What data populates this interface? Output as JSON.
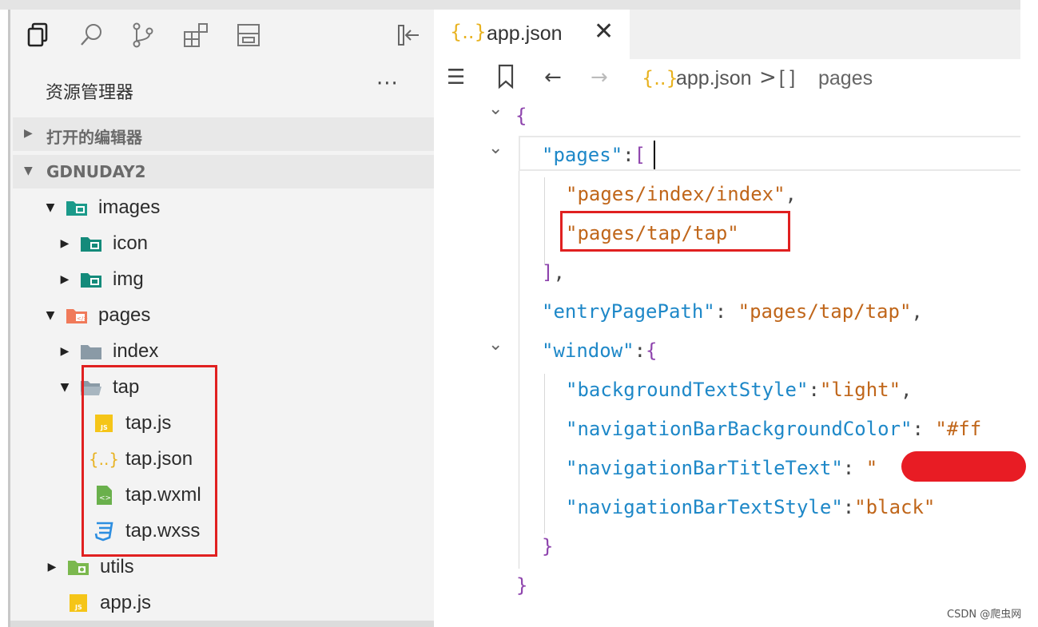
{
  "activity_bar": {
    "icons": [
      "files-icon",
      "search-icon",
      "source-control-icon",
      "extensions-icon",
      "panel-icon"
    ]
  },
  "explorer": {
    "title": "资源管理器",
    "more": "···",
    "open_editors_label": "打开的编辑器",
    "project_label": "GDNUDAY2"
  },
  "tree": {
    "images": "images",
    "icon": "icon",
    "img": "img",
    "pages": "pages",
    "index": "index",
    "tap": "tap",
    "tap_js": "tap.js",
    "tap_json": "tap.json",
    "tap_wxml": "tap.wxml",
    "tap_wxss": "tap.wxss",
    "utils": "utils",
    "app_js": "app.js"
  },
  "editor": {
    "tab": {
      "icon": "{..}",
      "label": "app.json",
      "close": "✕"
    },
    "breadcrumb": {
      "file_icon": "{..}",
      "file": "app.json",
      "sep": ">",
      "symbol_icon": "[ ]",
      "symbol": "pages"
    }
  },
  "code": {
    "l1_open": "{",
    "l2_key": "\"pages\"",
    "l2_colon": ":",
    "l2_bracket": "[",
    "l3_str": "\"pages/index/index\"",
    "l3_comma": ",",
    "l4_str": "\"pages/tap/tap\"",
    "l5_close": "]",
    "l5_comma": ",",
    "l6_key": "\"entryPagePath\"",
    "l6_colon": ": ",
    "l6_str": "\"pages/tap/tap\"",
    "l6_comma": ",",
    "l7_key": "\"window\"",
    "l7_colon": ":",
    "l7_brace": "{",
    "l8_key": "\"backgroundTextStyle\"",
    "l8_colon": ":",
    "l8_str": "\"light\"",
    "l8_comma": ",",
    "l9_key": "\"navigationBarBackgroundColor\"",
    "l9_colon": ": ",
    "l9_str": "\"#ff",
    "l10_key": "\"navigationBarTitleText\"",
    "l10_colon": ": ",
    "l10_str": "\"",
    "l11_key": "\"navigationBarTextStyle\"",
    "l11_colon": ":",
    "l11_str": "\"black\"",
    "l12_close": "}",
    "l13_close": "}"
  },
  "watermark": "CSDN @爬虫网",
  "colors": {
    "json_key": "#1e88c8",
    "json_string": "#c0661a",
    "bracket": "#8e44ad",
    "highlight_box": "#e02020",
    "redaction": "#e81c24"
  }
}
